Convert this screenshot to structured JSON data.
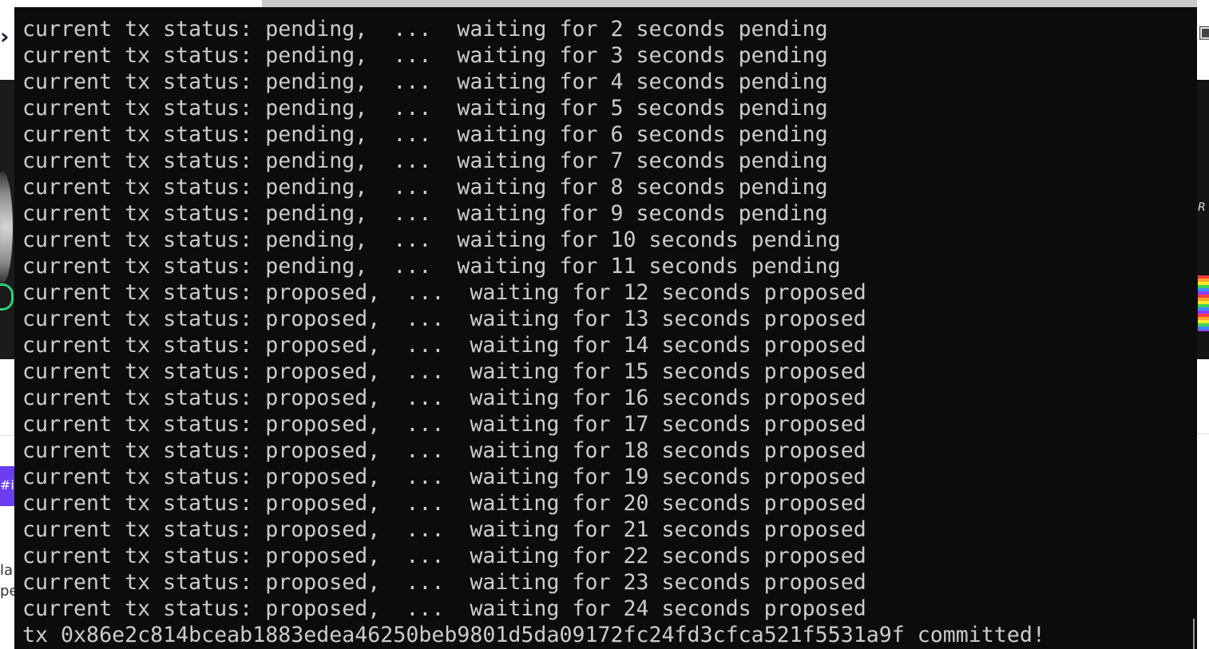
{
  "background": {
    "left_tag_text": "#in",
    "left_text_lines": [
      "la",
      "pe"
    ],
    "right_icon": "calendar-icon",
    "right_glyph": "R"
  },
  "terminal": {
    "lines": [
      "current tx status: pending,  ...  waiting for 2 seconds pending",
      "current tx status: pending,  ...  waiting for 3 seconds pending",
      "current tx status: pending,  ...  waiting for 4 seconds pending",
      "current tx status: pending,  ...  waiting for 5 seconds pending",
      "current tx status: pending,  ...  waiting for 6 seconds pending",
      "current tx status: pending,  ...  waiting for 7 seconds pending",
      "current tx status: pending,  ...  waiting for 8 seconds pending",
      "current tx status: pending,  ...  waiting for 9 seconds pending",
      "current tx status: pending,  ...  waiting for 10 seconds pending",
      "current tx status: pending,  ...  waiting for 11 seconds pending",
      "current tx status: proposed,  ...  waiting for 12 seconds proposed",
      "current tx status: proposed,  ...  waiting for 13 seconds proposed",
      "current tx status: proposed,  ...  waiting for 14 seconds proposed",
      "current tx status: proposed,  ...  waiting for 15 seconds proposed",
      "current tx status: proposed,  ...  waiting for 16 seconds proposed",
      "current tx status: proposed,  ...  waiting for 17 seconds proposed",
      "current tx status: proposed,  ...  waiting for 18 seconds proposed",
      "current tx status: proposed,  ...  waiting for 19 seconds proposed",
      "current tx status: proposed,  ...  waiting for 20 seconds proposed",
      "current tx status: proposed,  ...  waiting for 21 seconds proposed",
      "current tx status: proposed,  ...  waiting for 22 seconds proposed",
      "current tx status: proposed,  ...  waiting for 23 seconds proposed",
      "current tx status: proposed,  ...  waiting for 24 seconds proposed",
      "tx 0x86e2c814bceab1883edea46250beb9801d5da09172fc24fd3cfca521f5531a9f committed!"
    ],
    "colors": {
      "background": "#0c0c0c",
      "text": "#cccccc"
    }
  }
}
